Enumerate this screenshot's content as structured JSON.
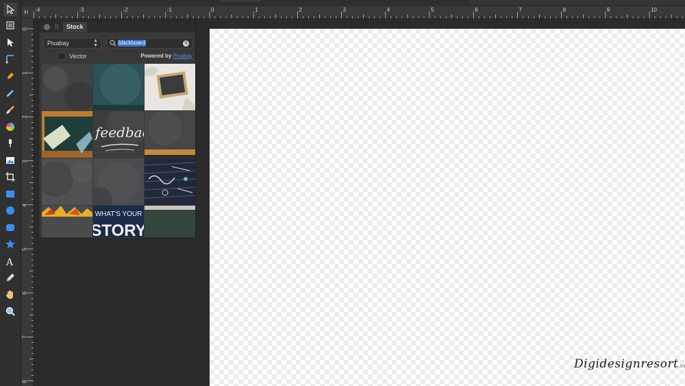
{
  "ruler": {
    "unit": "in",
    "top_ticks": [
      "-4",
      "-3",
      "-2",
      "-1",
      "0",
      "1",
      "2",
      "3",
      "4",
      "5",
      "6",
      "7",
      "8",
      "9",
      "10"
    ],
    "left_ticks": [
      "0",
      "1",
      "2",
      "3",
      "4",
      "5",
      "6",
      "7",
      "8"
    ]
  },
  "toolbar": {
    "tools": [
      "move-tool",
      "artboard-tool",
      "node-tool",
      "corner-tool",
      "pen-tool",
      "pencil-tool",
      "brush-tool",
      "fill-tool",
      "transparency-tool",
      "place-image-tool",
      "crop-tool",
      "rectangle-tool",
      "ellipse-tool",
      "rounded-rectangle-tool",
      "star-tool",
      "text-tool",
      "color-picker-tool",
      "hand-tool",
      "zoom-tool"
    ]
  },
  "stock_panel": {
    "tab_label": "Stock",
    "source_selected": "Pixabay",
    "search_value": "blackboard",
    "vector_label": "Vector",
    "powered_by_prefix": "Powered by",
    "powered_by_link": "Pixabay",
    "thumb_texts": {
      "feedback": "feedback",
      "story_top": "WHAT'S YOUR",
      "story_bottom": "STORY"
    }
  },
  "watermark": {
    "text": "Digidesignresort",
    "suffix": ".com"
  }
}
